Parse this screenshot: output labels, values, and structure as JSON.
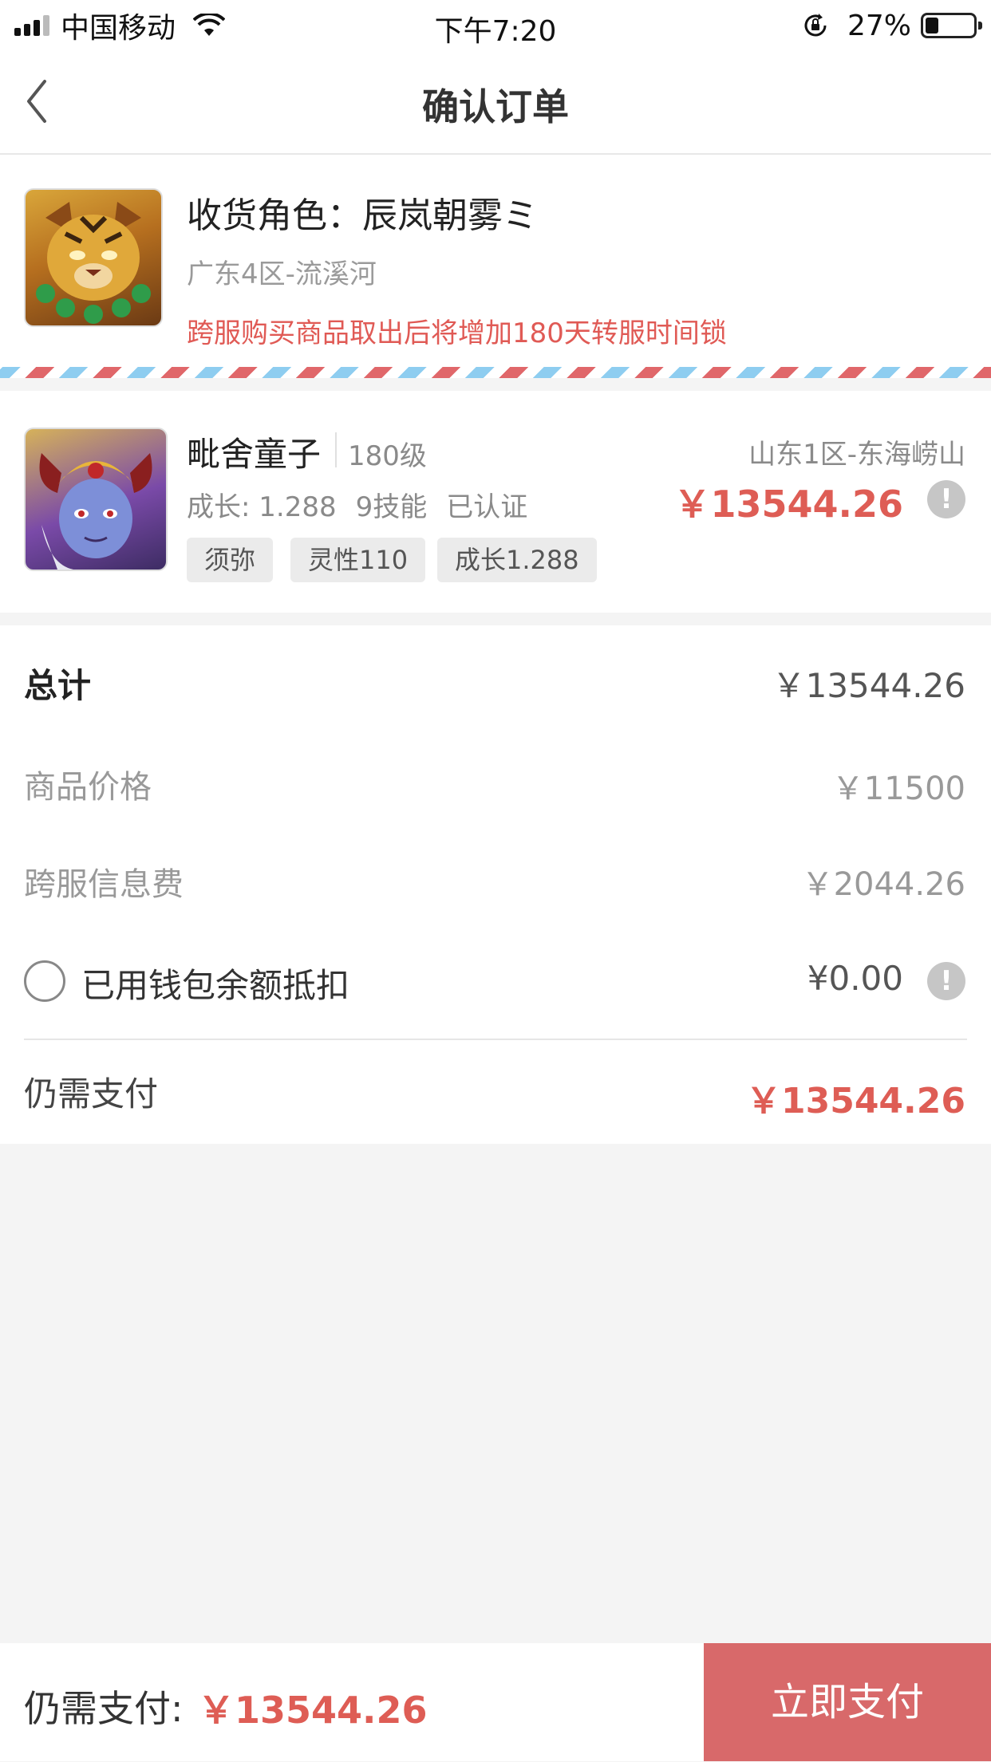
{
  "status_bar": {
    "carrier": "中国移动",
    "time": "下午7:20",
    "battery": "27%",
    "battery_level": 0.27
  },
  "nav": {
    "title": "确认订单"
  },
  "role": {
    "title": "收货角色：辰岚朝雾ミ",
    "server": "广东4区-流溪河",
    "warning": "跨服购买商品取出后将增加180天转服时间锁"
  },
  "item": {
    "name": "毗舍童子",
    "level": "180级",
    "server": "山东1区-东海崂山",
    "stats": [
      "成长: 1.288",
      "9技能",
      "已认证"
    ],
    "price": "￥13544.26",
    "tags": [
      "须弥",
      "灵性110",
      "成长1.288"
    ]
  },
  "summary": {
    "total_label": "总计",
    "total_value": "￥13544.26",
    "price_label": "商品价格",
    "price_value": "￥11500",
    "fee_label": "跨服信息费",
    "fee_value": "￥2044.26",
    "wallet_label": "已用钱包余额抵扣",
    "wallet_value": "¥0.00",
    "need_label": "仍需支付",
    "need_value": "￥13544.26"
  },
  "bottom": {
    "label": "仍需支付:",
    "amount": "￥13544.26",
    "pay_button": "立即支付"
  },
  "icons": {
    "back": "chevron-left-icon",
    "info": "exclamation-icon",
    "wifi": "wifi-icon",
    "rotation_lock": "rotation-lock-icon"
  },
  "colors": {
    "accent_red": "#de5d55",
    "pay_button": "#d8696a",
    "background": "#f4f4f4"
  }
}
